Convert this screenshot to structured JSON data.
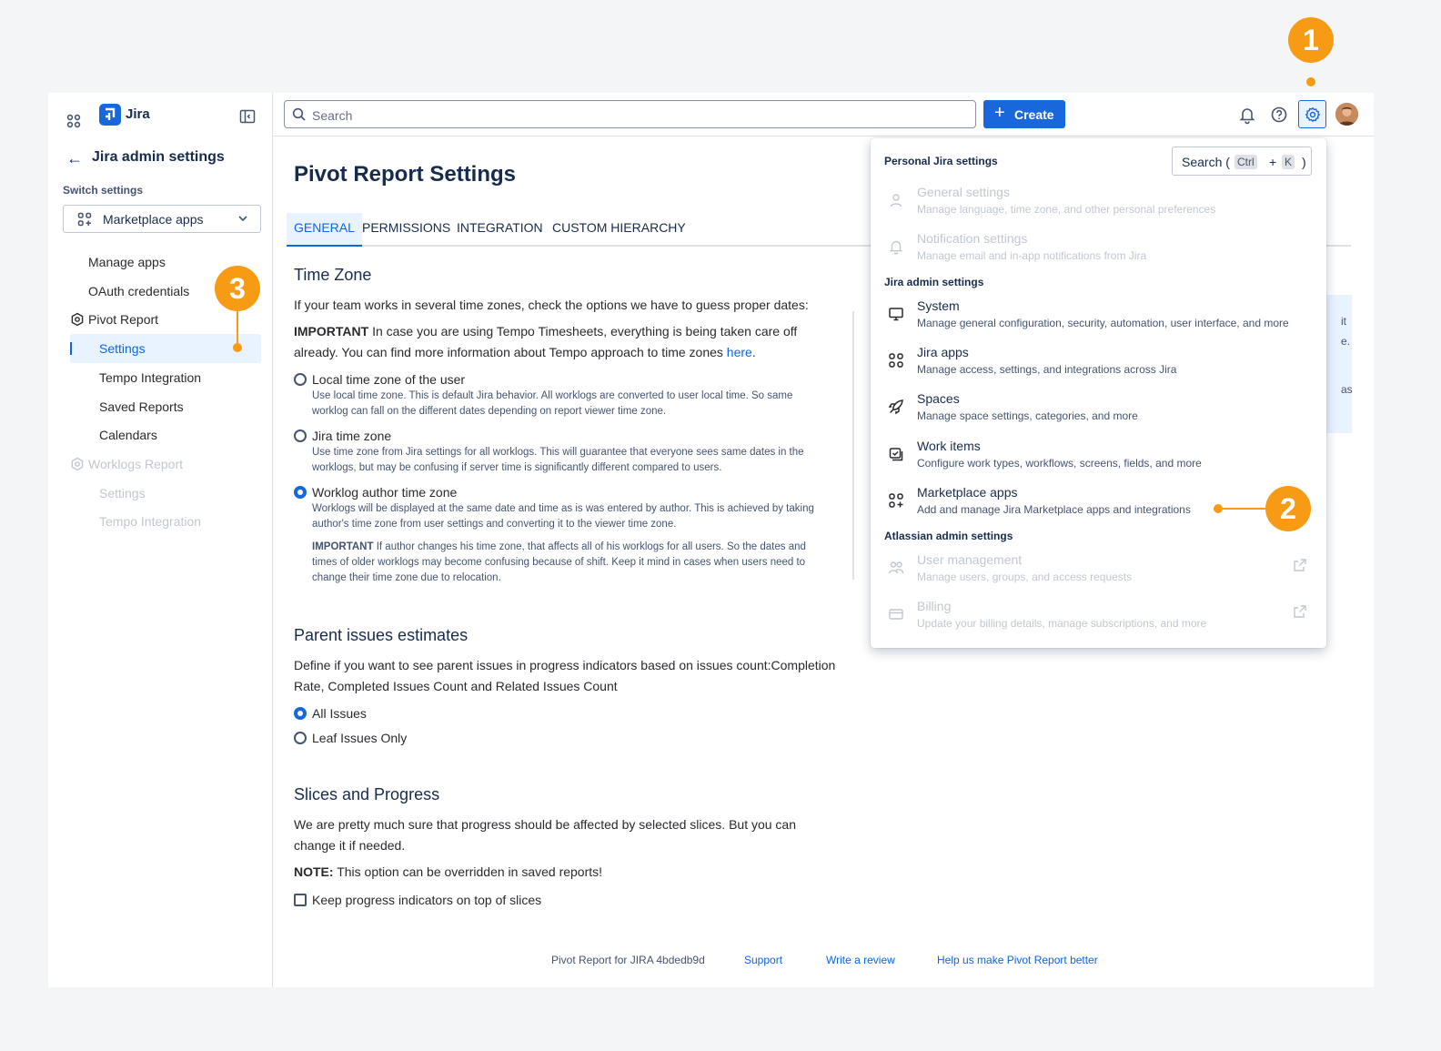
{
  "brand": {
    "name": "Jira",
    "color": "#1868db"
  },
  "sidebar": {
    "back_title": "Jira admin settings",
    "switch_label": "Switch settings",
    "switch_value": "Marketplace apps",
    "items": [
      {
        "label": "Manage apps"
      },
      {
        "label": "OAuth credentials"
      },
      {
        "label": "Pivot Report"
      },
      {
        "label": "Settings"
      },
      {
        "label": "Tempo Integration"
      },
      {
        "label": "Saved Reports"
      },
      {
        "label": "Calendars"
      },
      {
        "label": "Worklogs Report"
      },
      {
        "label": "Settings"
      },
      {
        "label": "Tempo Integration"
      }
    ]
  },
  "topbar": {
    "search_placeholder": "Search",
    "create_label": "Create"
  },
  "main": {
    "title": "Pivot Report Settings",
    "tabs": [
      "GENERAL",
      "PERMISSIONS",
      "INTEGRATION",
      "CUSTOM HIERARCHY"
    ],
    "timezone": {
      "title": "Time Zone",
      "intro": "If your team works in several time zones, check the options we have to guess proper dates:",
      "important_label": "IMPORTANT",
      "important_text": " In case you are using Tempo Timesheets, everything is being taken care off already. You can find more information about Tempo approach to time zones ",
      "here_link": "here",
      "period": ".",
      "options": [
        {
          "label": "Local time zone of the user",
          "desc": "Use local time zone. This is default Jira behavior. All worklogs are converted to user local time. So same worklog can fall on the different dates depending on report viewer time zone.",
          "selected": false
        },
        {
          "label": "Jira time zone",
          "desc": "Use time zone from Jira settings for all worklogs. This will guarantee that everyone sees same dates in the worklogs, but may be confusing if server time is significantly different compared to users.",
          "selected": false
        },
        {
          "label": "Worklog author time zone",
          "desc": "Worklogs will be displayed at the same date and time as is was entered by author. This is achieved by taking author's time zone from user settings and converting it to the viewer time zone.",
          "selected": true
        }
      ],
      "note_label": "IMPORTANT",
      "note_text": " If author changes his time zone, that affects all of his worklogs for all users. So the dates and times of older worklogs may become confusing because of shift. Keep it mind in cases when users need to change their time zone due to relocation."
    },
    "parent": {
      "title": "Parent issues estimates",
      "text": "Define if you want to see parent issues in progress indicators based on issues count:Completion Rate, Completed Issues Count and Related Issues Count",
      "options": [
        {
          "label": "All Issues",
          "selected": true
        },
        {
          "label": "Leaf Issues Only",
          "selected": false
        }
      ]
    },
    "slices": {
      "title": "Slices and Progress",
      "text": "We are pretty much sure that progress should be affected by selected slices. But you can change it if needed.",
      "note_label": "NOTE:",
      "note_text": " This option can be overridden in saved reports!",
      "checkbox_label": "Keep progress indicators on top of slices"
    },
    "panel_fragments": [
      "it",
      "e.",
      "as"
    ]
  },
  "footer": {
    "version": "Pivot Report for JIRA 4bdedb9d",
    "support": "Support",
    "review": "Write a review",
    "help": "Help us make Pivot Report better"
  },
  "dropdown": {
    "personal_title": "Personal Jira settings",
    "search": {
      "label": "Search (",
      "key1": "Ctrl",
      "plus": "+",
      "key2": "K",
      "close": ")"
    },
    "personal_items": [
      {
        "title": "General settings",
        "desc": "Manage language, time zone, and other personal preferences",
        "icon": "person-icon"
      },
      {
        "title": "Notification settings",
        "desc": "Manage email and in-app notifications from Jira",
        "icon": "bell-icon"
      }
    ],
    "admin_title": "Jira admin settings",
    "admin_items": [
      {
        "title": "System",
        "desc": "Manage general configuration, security, automation, user interface, and more",
        "icon": "monitor-icon"
      },
      {
        "title": "Jira apps",
        "desc": "Manage access, settings, and integrations across Jira",
        "icon": "apps-grid-icon"
      },
      {
        "title": "Spaces",
        "desc": "Manage space settings, categories, and more",
        "icon": "rocket-icon"
      },
      {
        "title": "Work items",
        "desc": "Configure work types, workflows, screens, fields, and more",
        "icon": "work-items-icon"
      },
      {
        "title": "Marketplace apps",
        "desc": "Add and manage Jira Marketplace apps and integrations",
        "icon": "marketplace-icon"
      }
    ],
    "atlassian_title": "Atlassian admin settings",
    "atlassian_items": [
      {
        "title": "User management",
        "desc": "Manage users, groups, and access requests",
        "icon": "people-icon"
      },
      {
        "title": "Billing",
        "desc": "Update your billing details, manage subscriptions, and more",
        "icon": "credit-card-icon"
      }
    ]
  },
  "callouts": [
    "1",
    "2",
    "3"
  ],
  "colors": {
    "accent": "#1868db",
    "callout": "#f79a14",
    "selected_bg": "#e9f2ff"
  }
}
